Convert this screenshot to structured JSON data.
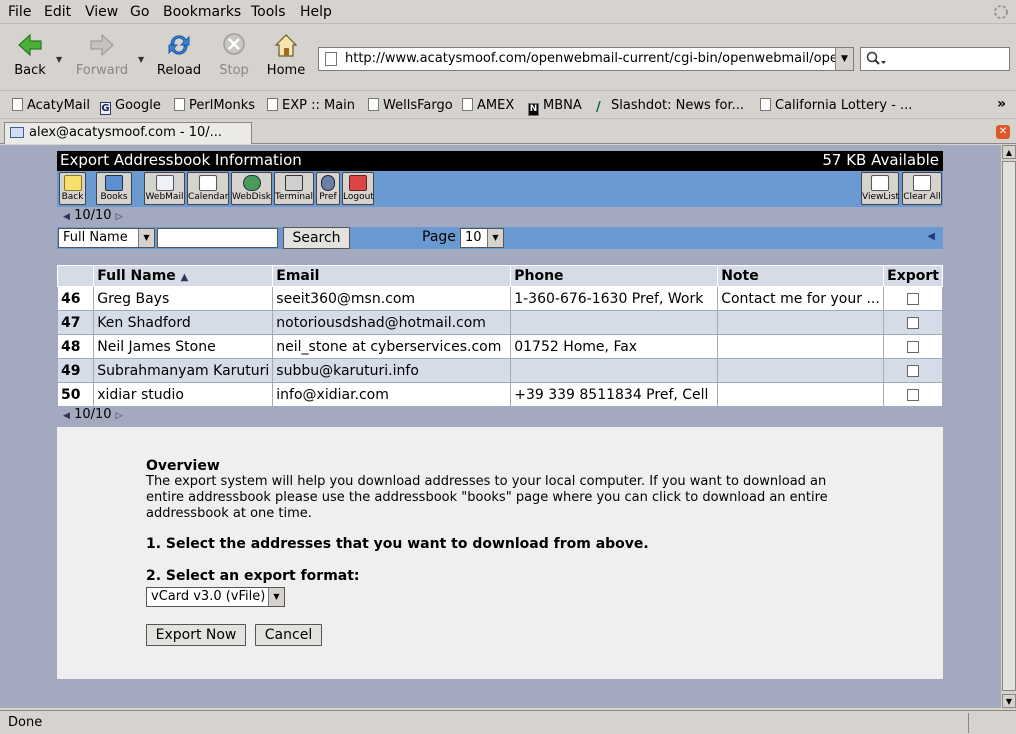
{
  "menubar": {
    "items": [
      "File",
      "Edit",
      "View",
      "Go",
      "Bookmarks",
      "Tools",
      "Help"
    ]
  },
  "navbar": {
    "back": "Back",
    "forward": "Forward",
    "reload": "Reload",
    "stop": "Stop",
    "home": "Home",
    "url": "http://www.acatysmoof.com/openwebmail-current/cgi-bin/openwebmail/openw"
  },
  "bookmarks": [
    "AcatyMail",
    "Google",
    "PerlMonks",
    "EXP :: Main",
    "WellsFargo",
    "AMEX",
    "MBNA",
    "Slashdot: News for...",
    "California Lottery - ..."
  ],
  "tab": {
    "title": "alex@acatysmoof.com - 10/..."
  },
  "page": {
    "title": "Export Addressbook Information",
    "available": "57 KB Available",
    "toolbar": {
      "back": "Back",
      "books": "Books",
      "webmail": "WebMail",
      "calendar": "Calendar",
      "webdisk": "WebDisk",
      "terminal": "Terminal",
      "pref": "Pref",
      "logout": "Logout",
      "viewlist": "ViewList",
      "clearall": "Clear All"
    },
    "pager": "10/10",
    "search": {
      "field": "Full Name",
      "button": "Search",
      "page_label": "Page",
      "page_value": "10"
    },
    "table": {
      "headers": [
        "",
        "Full Name",
        "Email",
        "Phone",
        "Note",
        "Export"
      ],
      "rows": [
        {
          "num": "46",
          "name": "Greg Bays",
          "email": "seeit360@msn.com",
          "phone": "1-360-676-1630 Pref, Work",
          "note": "Contact me for your ..."
        },
        {
          "num": "47",
          "name": "Ken Shadford",
          "email": "notoriousdshad@hotmail.com",
          "phone": "",
          "note": ""
        },
        {
          "num": "48",
          "name": "Neil James Stone",
          "email": "neil_stone at cyberservices.com",
          "phone": "01752 Home, Fax",
          "note": ""
        },
        {
          "num": "49",
          "name": "Subrahmanyam Karuturi",
          "email": "subbu@karuturi.info",
          "phone": "",
          "note": ""
        },
        {
          "num": "50",
          "name": "xidiar studio",
          "email": "info@xidiar.com",
          "phone": "+39 339 8511834 Pref, Cell",
          "note": ""
        }
      ]
    },
    "overview": {
      "heading": "Overview",
      "text": "The export system will help you download addresses to your local computer. If you want to download an entire addressbook please use the addressbook \"books\" page where you can click to download an entire addressbook at one time.",
      "step1": "1. Select the addresses that you want to download from above.",
      "step2": "2. Select an export format:",
      "format": "vCard v3.0 (vFile)",
      "export_button": "Export Now",
      "cancel_button": "Cancel"
    }
  },
  "status": "Done",
  "colors": {
    "toolbar_blue": "#6b9ad2",
    "content_bg": "#a3aabf",
    "row_alt": "#d6dbe8"
  }
}
